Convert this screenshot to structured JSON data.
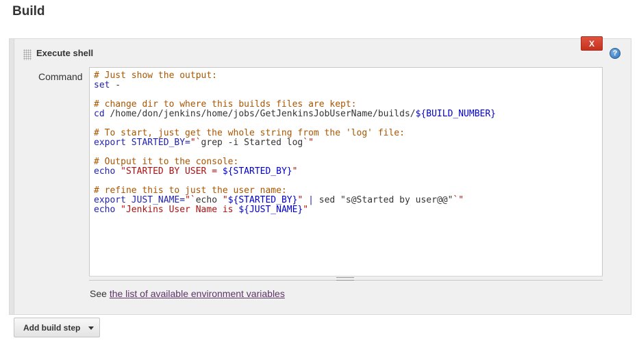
{
  "section": {
    "title": "Build"
  },
  "build_step": {
    "title": "Execute shell",
    "delete_label": "X",
    "help_label": "?",
    "command_label": "Command",
    "command_lines": [
      [
        {
          "t": "# Just show the output:",
          "c": "comment"
        }
      ],
      [
        {
          "t": "set",
          "c": "kw"
        },
        {
          "t": " -",
          "c": "plain"
        }
      ],
      [],
      [
        {
          "t": "# change dir to where this builds files are kept:",
          "c": "comment"
        }
      ],
      [
        {
          "t": "cd",
          "c": "kw"
        },
        {
          "t": " /home/don/jenkins/home/jobs/GetJenkinsJobUserName/builds/",
          "c": "plain"
        },
        {
          "t": "${BUILD_NUMBER}",
          "c": "var"
        }
      ],
      [],
      [
        {
          "t": "# To start, just get the whole string from the 'log' file:",
          "c": "comment"
        }
      ],
      [
        {
          "t": "export",
          "c": "kw"
        },
        {
          "t": " STARTED_BY=",
          "c": "kw"
        },
        {
          "t": "\"`",
          "c": "str"
        },
        {
          "t": "grep -i Started log",
          "c": "plain"
        },
        {
          "t": "`\"",
          "c": "str"
        }
      ],
      [],
      [
        {
          "t": "# Output it to the console:",
          "c": "comment"
        }
      ],
      [
        {
          "t": "echo",
          "c": "kw"
        },
        {
          "t": " \"STARTED BY USER = ",
          "c": "str"
        },
        {
          "t": "${STARTED_BY}",
          "c": "var"
        },
        {
          "t": "\"",
          "c": "str"
        }
      ],
      [],
      [
        {
          "t": "# refine this to just the user name:",
          "c": "comment"
        }
      ],
      [
        {
          "t": "export",
          "c": "kw"
        },
        {
          "t": " JUST_NAME=",
          "c": "kw"
        },
        {
          "t": "\"`",
          "c": "str"
        },
        {
          "t": "echo",
          "c": "plain"
        },
        {
          "t": " \"",
          "c": "str"
        },
        {
          "t": "${STARTED_BY}",
          "c": "var"
        },
        {
          "t": "\"",
          "c": "str"
        },
        {
          "t": " | ",
          "c": "kw"
        },
        {
          "t": "sed",
          "c": "plain"
        },
        {
          "t": " \"s@Started by user@@\"",
          "c": "plain"
        },
        {
          "t": "`\"",
          "c": "str"
        }
      ],
      [
        {
          "t": "echo",
          "c": "kw"
        },
        {
          "t": " \"Jenkins User Name is ",
          "c": "str"
        },
        {
          "t": "${JUST_NAME}",
          "c": "var"
        },
        {
          "t": "\"",
          "c": "str"
        }
      ]
    ],
    "env_prefix": "See ",
    "env_link": "the list of available environment variables"
  },
  "add_step": {
    "label": "Add build step"
  }
}
